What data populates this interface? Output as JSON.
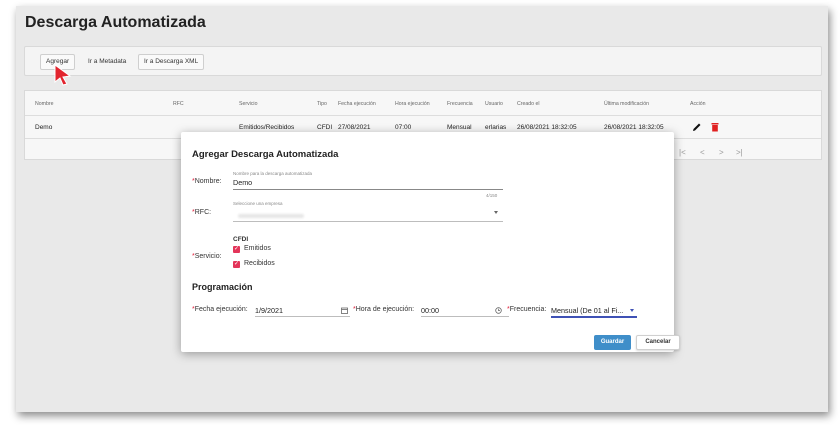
{
  "page": {
    "title": "Descarga Automatizada"
  },
  "toolbar": {
    "agregar": "Agregar",
    "metadata": "Ir a Metadata",
    "descarga_xml": "Ir a Descarga XML"
  },
  "table": {
    "headers": {
      "nombre": "Nombre",
      "rfc": "RFC",
      "servicio": "Servicio",
      "tipo": "Tipo",
      "fecha_ejecucion": "Fecha ejecución",
      "hora_ejecucion": "Hora ejecución",
      "frecuencia": "Frecuencia",
      "usuario": "Usuario",
      "creado_el": "Creado el",
      "ultima_modificacion": "Última modificación",
      "accion": "Acción"
    },
    "row": {
      "nombre": "Demo",
      "servicio": "Emitidos/Recibidos",
      "tipo": "CFDI",
      "fecha_ejecucion": "27/08/2021",
      "hora_ejecucion": "07:00",
      "frecuencia": "Mensual",
      "usuario": "erlarias",
      "creado_el": "26/08/2021 18:32:05",
      "ultima_modificacion": "26/08/2021 18:32:05"
    },
    "pager": {
      "first": "|<",
      "prev": "<",
      "next": ">",
      "last": ">|"
    }
  },
  "modal": {
    "title": "Agregar Descarga Automatizada",
    "nombre": {
      "label": "Nombre:",
      "hint": "Nombre para la descarga automatizada",
      "value": "Demo",
      "counter": "4/150"
    },
    "rfc": {
      "label": "RFC:",
      "hint": "Seleccione una empresa"
    },
    "servicio": {
      "label": "Servicio:",
      "group": "CFDI",
      "options": [
        "Emitidos",
        "Recibidos"
      ]
    },
    "programacion": {
      "title": "Programación",
      "fecha_label": "Fecha ejecución:",
      "fecha_value": "1/9/2021",
      "hora_label": "Hora de ejecución:",
      "hora_value": "00:00",
      "frecuencia_label": "Frecuencia:",
      "frecuencia_value": "Mensual (De 01 al Fi..."
    },
    "buttons": {
      "guardar": "Guardar",
      "cancelar": "Cancelar"
    }
  },
  "colors": {
    "accent": "#3f8ec9",
    "required": "#e0203b",
    "checkbox": "#e3355a",
    "delete": "#e02020"
  },
  "icons": {
    "cursor": "pointer-arrow-icon",
    "edit": "pencil-icon",
    "delete": "trash-icon",
    "calendar": "calendar-icon",
    "clock": "clock-icon",
    "dropdown": "chevron-down-icon"
  }
}
